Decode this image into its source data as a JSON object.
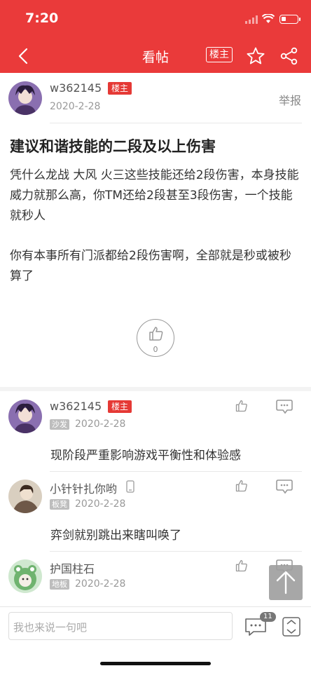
{
  "status": {
    "time": "7:20",
    "battery_level": 0.3
  },
  "nav": {
    "title": "看帖",
    "louzhu_label": "楼主"
  },
  "post": {
    "author": "w362145",
    "author_badge": "楼主",
    "date": "2020-2-28",
    "report_label": "举报",
    "title": "建议和谐技能的二段及以上伤害",
    "paragraphs": [
      "凭什么龙战 大风 火三这些技能还给2段伤害，本身技能威力就那么高，你TM还给2段甚至3段伤害，一个技能就秒人",
      "你有本事所有门派都给2段伤害啊，全部就是秒或被秒算了"
    ],
    "like_count": "0"
  },
  "comments": [
    {
      "author": "w362145",
      "badge": "楼主",
      "floor": "沙发",
      "date": "2020-2-28",
      "text": "现阶段严重影响游戏平衡性和体验感"
    },
    {
      "author": "小针针扎你哟",
      "floor": "板凳",
      "date": "2020-2-28",
      "text": "弈剑就别跳出来瞎叫唤了"
    },
    {
      "author": "护国柱石",
      "floor": "地板",
      "date": "2020-2-28",
      "text": ""
    }
  ],
  "bottom": {
    "input_placeholder": "我也来说一句吧",
    "comment_count": "11"
  },
  "colors": {
    "brand": "#ea3a3a",
    "badge": "#e53935"
  }
}
